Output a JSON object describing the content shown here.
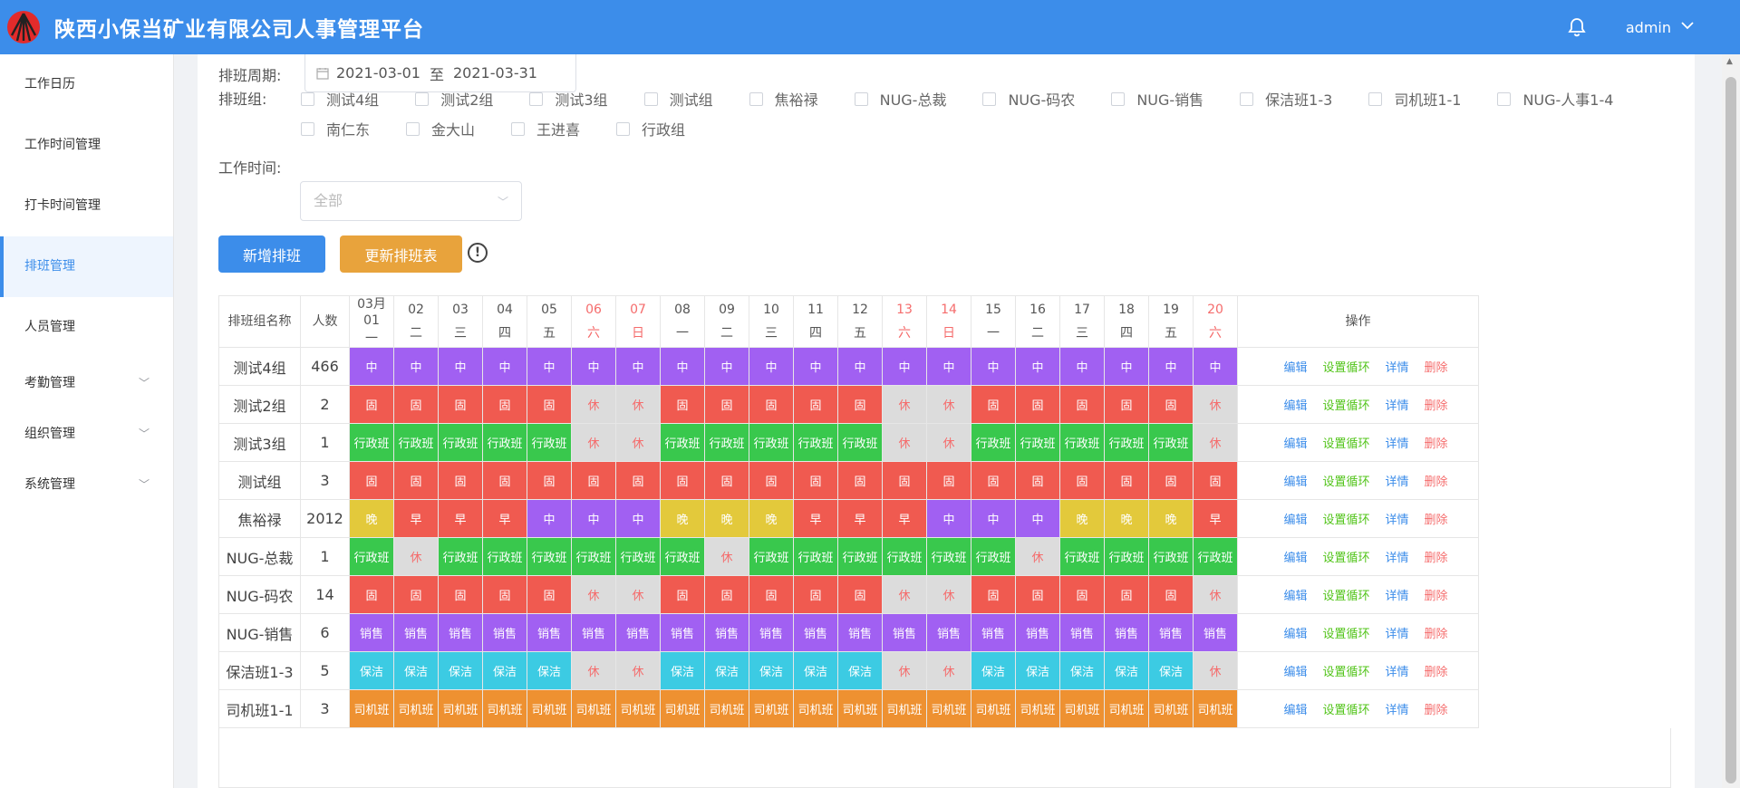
{
  "header": {
    "title": "陕西小保当矿业有限公司人事管理平台",
    "user": "admin",
    "logo_icon": "company-logo"
  },
  "sidebar": {
    "items": [
      {
        "label": "工作日历"
      },
      {
        "label": "工作时间管理"
      },
      {
        "label": "打卡时间管理"
      },
      {
        "label": "排班管理",
        "active": true
      },
      {
        "label": "人员管理"
      },
      {
        "label": "考勤管理",
        "expandable": true
      },
      {
        "label": "组织管理",
        "expandable": true
      },
      {
        "label": "系统管理",
        "expandable": true
      }
    ]
  },
  "filters": {
    "period_label": "排班周期:",
    "period_start": "2021-03-01",
    "period_sep": "至",
    "period_end": "2021-03-31",
    "group_label": "排班组:",
    "groups": [
      "测试4组",
      "测试2组",
      "测试3组",
      "测试组",
      "焦裕禄",
      "NUG-总裁",
      "NUG-码农",
      "NUG-销售",
      "保洁班1-3",
      "司机班1-1",
      "NUG-人事1-4",
      "南仁东",
      "金大山",
      "王进喜",
      "行政组"
    ],
    "worktime_label": "工作时间:",
    "worktime_placeholder": "全部"
  },
  "actions": {
    "add_label": "新增排班",
    "update_label": "更新排班表",
    "add_color": "#3c8dea",
    "update_color": "#e8a33c"
  },
  "table": {
    "col_name": "排班组名称",
    "col_count": "人数",
    "col_ops": "操作",
    "days": [
      {
        "d": "03月\n01",
        "w": "一",
        "weekend": false
      },
      {
        "d": "02",
        "w": "二",
        "weekend": false
      },
      {
        "d": "03",
        "w": "三",
        "weekend": false
      },
      {
        "d": "04",
        "w": "四",
        "weekend": false
      },
      {
        "d": "05",
        "w": "五",
        "weekend": false
      },
      {
        "d": "06",
        "w": "六",
        "weekend": true
      },
      {
        "d": "07",
        "w": "日",
        "weekend": true
      },
      {
        "d": "08",
        "w": "一",
        "weekend": false
      },
      {
        "d": "09",
        "w": "二",
        "weekend": false
      },
      {
        "d": "10",
        "w": "三",
        "weekend": false
      },
      {
        "d": "11",
        "w": "四",
        "weekend": false
      },
      {
        "d": "12",
        "w": "五",
        "weekend": false
      },
      {
        "d": "13",
        "w": "六",
        "weekend": true
      },
      {
        "d": "14",
        "w": "日",
        "weekend": true
      },
      {
        "d": "15",
        "w": "一",
        "weekend": false
      },
      {
        "d": "16",
        "w": "二",
        "weekend": false
      },
      {
        "d": "17",
        "w": "三",
        "weekend": false
      },
      {
        "d": "18",
        "w": "四",
        "weekend": false
      },
      {
        "d": "19",
        "w": "五",
        "weekend": false
      },
      {
        "d": "20",
        "w": "六",
        "weekend": true
      }
    ],
    "ops": [
      "编辑",
      "设置循环",
      "详情",
      "删除"
    ],
    "rows": [
      {
        "name": "测试4组",
        "count": "466",
        "shifts": [
          "中",
          "中",
          "中",
          "中",
          "中",
          "中",
          "中",
          "中",
          "中",
          "中",
          "中",
          "中",
          "中",
          "中",
          "中",
          "中",
          "中",
          "中",
          "中",
          "中"
        ]
      },
      {
        "name": "测试2组",
        "count": "2",
        "shifts": [
          "固",
          "固",
          "固",
          "固",
          "固",
          "休",
          "休",
          "固",
          "固",
          "固",
          "固",
          "固",
          "休",
          "休",
          "固",
          "固",
          "固",
          "固",
          "固",
          "休"
        ]
      },
      {
        "name": "测试3组",
        "count": "1",
        "shifts": [
          "行政班",
          "行政班",
          "行政班",
          "行政班",
          "行政班",
          "休",
          "休",
          "行政班",
          "行政班",
          "行政班",
          "行政班",
          "行政班",
          "休",
          "休",
          "行政班",
          "行政班",
          "行政班",
          "行政班",
          "行政班",
          "休"
        ]
      },
      {
        "name": "测试组",
        "count": "3",
        "shifts": [
          "固",
          "固",
          "固",
          "固",
          "固",
          "固",
          "固",
          "固",
          "固",
          "固",
          "固",
          "固",
          "固",
          "固",
          "固",
          "固",
          "固",
          "固",
          "固",
          "固"
        ]
      },
      {
        "name": "焦裕禄",
        "count": "2012",
        "shifts": [
          "晚",
          "早",
          "早",
          "早",
          "中",
          "中",
          "中",
          "晚",
          "晚",
          "晚",
          "早",
          "早",
          "早",
          "中",
          "中",
          "中",
          "晚",
          "晚",
          "晚",
          "早"
        ]
      },
      {
        "name": "NUG-总裁",
        "count": "1",
        "shifts": [
          "行政班",
          "休",
          "行政班",
          "行政班",
          "行政班",
          "行政班",
          "行政班",
          "行政班",
          "休",
          "行政班",
          "行政班",
          "行政班",
          "行政班",
          "行政班",
          "行政班",
          "休",
          "行政班",
          "行政班",
          "行政班",
          "行政班"
        ]
      },
      {
        "name": "NUG-码农",
        "count": "14",
        "shifts": [
          "固",
          "固",
          "固",
          "固",
          "固",
          "休",
          "休",
          "固",
          "固",
          "固",
          "固",
          "固",
          "休",
          "休",
          "固",
          "固",
          "固",
          "固",
          "固",
          "休"
        ]
      },
      {
        "name": "NUG-销售",
        "count": "6",
        "shifts": [
          "销售",
          "销售",
          "销售",
          "销售",
          "销售",
          "销售",
          "销售",
          "销售",
          "销售",
          "销售",
          "销售",
          "销售",
          "销售",
          "销售",
          "销售",
          "销售",
          "销售",
          "销售",
          "销售",
          "销售"
        ]
      },
      {
        "name": "保洁班1-3",
        "count": "5",
        "shifts": [
          "保洁",
          "保洁",
          "保洁",
          "保洁",
          "保洁",
          "休",
          "休",
          "保洁",
          "保洁",
          "保洁",
          "保洁",
          "保洁",
          "休",
          "休",
          "保洁",
          "保洁",
          "保洁",
          "保洁",
          "保洁",
          "休"
        ]
      },
      {
        "name": "司机班1-1",
        "count": "3",
        "shifts": [
          "司机班",
          "司机班",
          "司机班",
          "司机班",
          "司机班",
          "司机班",
          "司机班",
          "司机班",
          "司机班",
          "司机班",
          "司机班",
          "司机班",
          "司机班",
          "司机班",
          "司机班",
          "司机班",
          "司机班",
          "司机班",
          "司机班",
          "司机班"
        ]
      }
    ]
  },
  "shift_colors": {
    "中": "#a160f2",
    "固": "#f05a50",
    "休": "#dcdcdc",
    "行政班": "#39c84d",
    "晚": "#e3c93b",
    "早": "#f05a50",
    "销售": "#a160f2",
    "保洁": "#3ccbe3",
    "司机班": "#ee9131"
  }
}
